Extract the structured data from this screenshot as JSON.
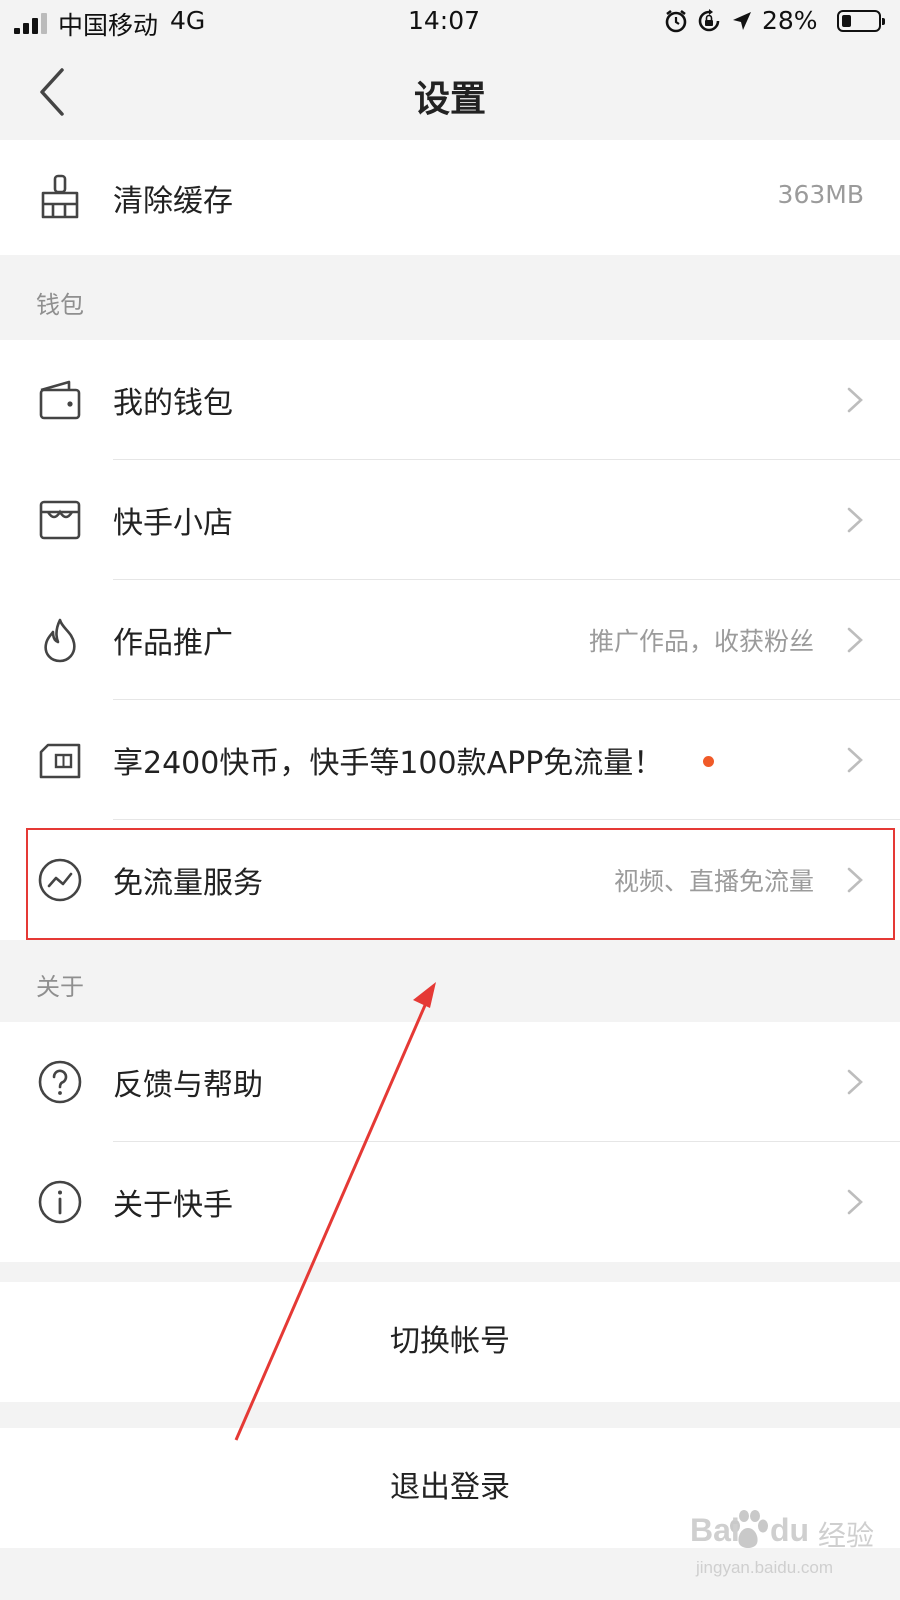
{
  "status_bar": {
    "carrier": "中国移动",
    "network": "4G",
    "time": "14:07",
    "battery": "28%",
    "battery_level": 0.28
  },
  "header": {
    "title": "设置",
    "back_icon": "chevron-left-icon"
  },
  "cache": {
    "label": "清除缓存",
    "value": "363MB",
    "icon": "broom-icon"
  },
  "wallet_section": {
    "title": "钱包",
    "items": [
      {
        "label": "我的钱包",
        "value": "",
        "icon": "wallet-icon"
      },
      {
        "label": "快手小店",
        "value": "",
        "icon": "shop-icon"
      },
      {
        "label": "作品推广",
        "value": "推广作品，收获粉丝",
        "icon": "flame-icon"
      },
      {
        "label": "享2400快币，快手等100款APP免流量！",
        "value": "",
        "icon": "sim-card-icon",
        "badge_color": "#f05a28"
      },
      {
        "label": "免流量服务",
        "value": "视频、直播免流量",
        "icon": "traffic-free-icon"
      }
    ]
  },
  "about_section": {
    "title": "关于",
    "items": [
      {
        "label": "反馈与帮助",
        "icon": "question-circle-icon"
      },
      {
        "label": "关于快手",
        "icon": "info-circle-icon"
      }
    ]
  },
  "actions": {
    "switch_account": "切换帐号",
    "logout": "退出登录"
  },
  "annotation": {
    "highlight_color": "#e53935"
  },
  "watermark": {
    "brand": "Bai",
    "brand_suffix": "du",
    "site_cn": "经验",
    "url": "jingyan.baidu.com"
  }
}
